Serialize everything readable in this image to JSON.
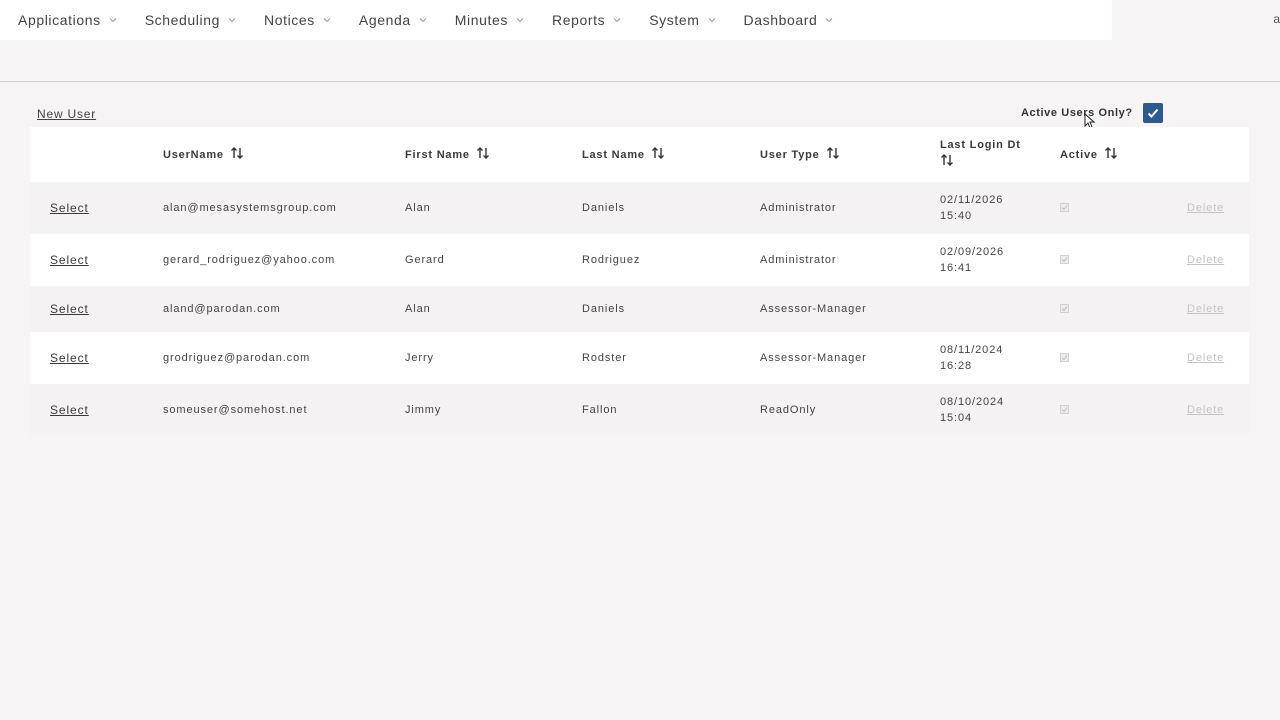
{
  "nav": {
    "items": [
      {
        "label": "Applications"
      },
      {
        "label": "Scheduling"
      },
      {
        "label": "Notices"
      },
      {
        "label": "Agenda"
      },
      {
        "label": "Minutes"
      },
      {
        "label": "Reports"
      },
      {
        "label": "System"
      },
      {
        "label": "Dashboard"
      }
    ],
    "corner": "a"
  },
  "toolbar": {
    "new_user_label": "New User",
    "active_only_label": "Active Users Only?",
    "active_only_checked": true
  },
  "table": {
    "columns": {
      "username": "UserName",
      "first_name": "First Name",
      "last_name": "Last Name",
      "user_type": "User Type",
      "last_login_line1": "Last Login Dt",
      "active": "Active"
    },
    "select_label": "Select",
    "delete_label": "Delete",
    "rows": [
      {
        "username": "alan@mesasystemsgroup.com",
        "first": "Alan",
        "last": "Daniels",
        "type": "Administrator",
        "login_date": "02/11/2026",
        "login_time": "15:40",
        "active": true
      },
      {
        "username": "gerard_rodriguez@yahoo.com",
        "first": "Gerard",
        "last": "Rodriguez",
        "type": "Administrator",
        "login_date": "02/09/2026",
        "login_time": "16:41",
        "active": true
      },
      {
        "username": "aland@parodan.com",
        "first": "Alan",
        "last": "Daniels",
        "type": "Assessor-Manager",
        "login_date": "",
        "login_time": "",
        "active": true
      },
      {
        "username": "grodriguez@parodan.com",
        "first": "Jerry",
        "last": "Rodster",
        "type": "Assessor-Manager",
        "login_date": "08/11/2024",
        "login_time": "16:28",
        "active": true
      },
      {
        "username": "someuser@somehost.net",
        "first": "Jimmy",
        "last": "Fallon",
        "type": "ReadOnly",
        "login_date": "08/10/2024",
        "login_time": "15:04",
        "active": true
      }
    ]
  },
  "colors": {
    "accent_checkbox": "#2c5a8c",
    "page_bg": "#f6f4f4",
    "delete_disabled": "#c4c4c4"
  }
}
